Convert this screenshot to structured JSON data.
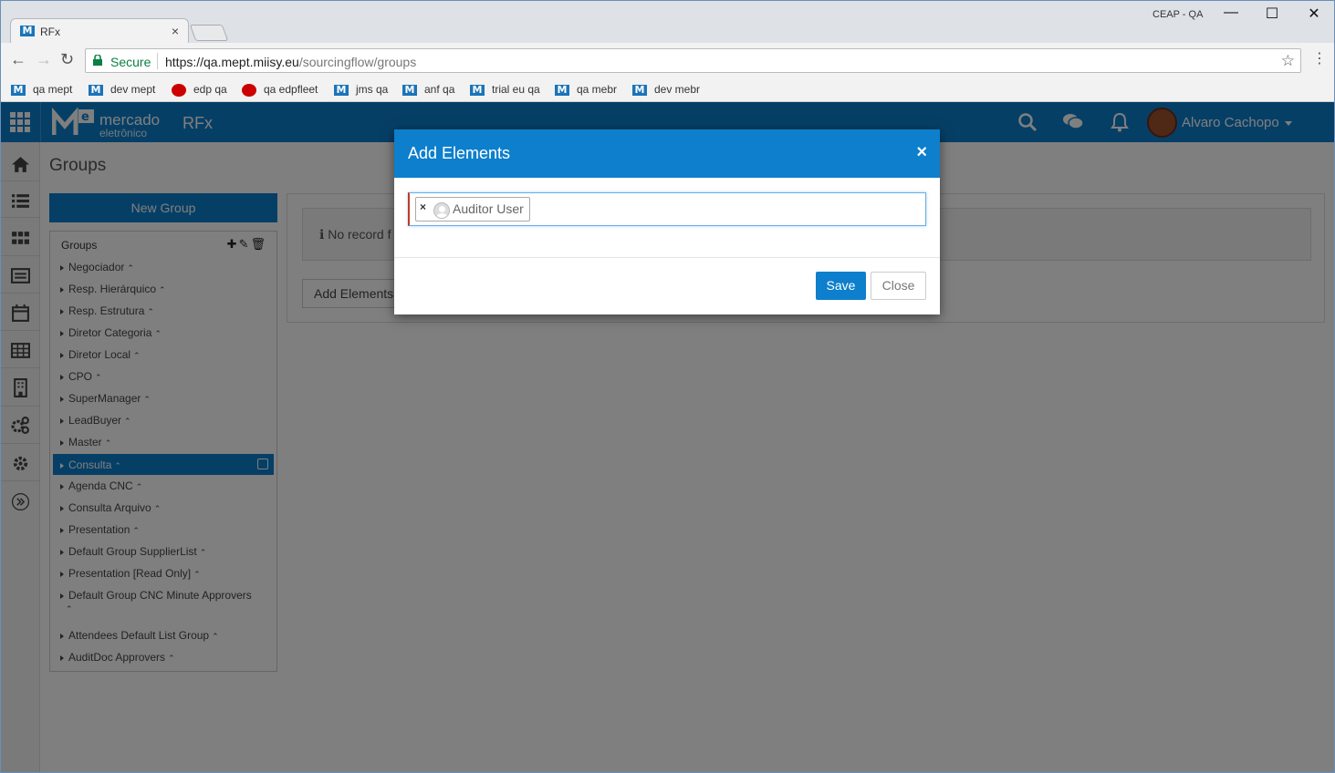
{
  "browser": {
    "tab_title": "RFx",
    "profile": "CEAP - QA",
    "secure_label": "Secure",
    "url_host": "https://qa.mept.miisy.eu",
    "url_path": "/sourcingflow/groups",
    "bookmarks": [
      {
        "label": "qa mept",
        "icon": "m"
      },
      {
        "label": "dev mept",
        "icon": "m"
      },
      {
        "label": "edp qa",
        "icon": "edp"
      },
      {
        "label": "qa edpfleet",
        "icon": "edp"
      },
      {
        "label": "jms qa",
        "icon": "m"
      },
      {
        "label": "anf qa",
        "icon": "m"
      },
      {
        "label": "trial eu qa",
        "icon": "m"
      },
      {
        "label": "qa mebr",
        "icon": "m"
      },
      {
        "label": "dev mebr",
        "icon": "m"
      }
    ]
  },
  "app": {
    "brand_line1": "mercado",
    "brand_line2": "eletrônico",
    "app_name": "RFx",
    "user_name": "Alvaro Cachopo",
    "accent": "#0d7fcc"
  },
  "page": {
    "title": "Groups",
    "new_group_label": "New Group",
    "panel_header": "Groups",
    "groups": [
      "Negociador",
      "Resp. Hierárquico",
      "Resp. Estrutura",
      "Diretor Categoria",
      "Diretor Local",
      "CPO",
      "SuperManager",
      "LeadBuyer",
      "Master",
      "Consulta",
      "Agenda CNC",
      "Consulta Arquivo",
      "Presentation",
      "Default Group SupplierList",
      "Presentation [Read Only]",
      "Default Group CNC Minute Approvers",
      "Attendees Default List Group",
      "AuditDoc Approvers"
    ],
    "selected_group": "Consulta",
    "no_record_text": "No record f",
    "add_elements_label": "Add Elements"
  },
  "modal": {
    "title": "Add Elements",
    "tag_label": "Auditor User",
    "save_label": "Save",
    "close_label": "Close"
  }
}
